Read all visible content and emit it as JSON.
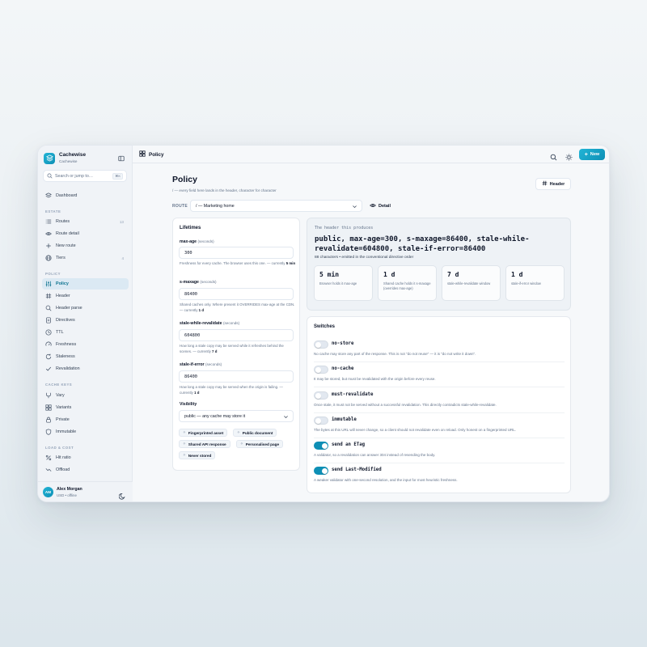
{
  "app": {
    "name": "Cachewise",
    "workspace": "Cachewise",
    "accent": "#0e8fb5"
  },
  "search": {
    "placeholder": "Search or jump to…",
    "shortcut": "⌘K"
  },
  "nav": {
    "dashboard": "Dashboard",
    "sections": [
      {
        "label": "ESTATE"
      },
      {
        "label": "POLICY"
      },
      {
        "label": "CACHE KEYS"
      },
      {
        "label": "LOAD & COST"
      }
    ],
    "estate": [
      {
        "label": "Routes",
        "count": "13",
        "icon": "list-icon"
      },
      {
        "label": "Route detail",
        "icon": "eye-icon"
      },
      {
        "label": "New route",
        "icon": "plus-icon"
      },
      {
        "label": "Tiers",
        "count": "4",
        "icon": "globe-icon"
      }
    ],
    "policy": [
      {
        "label": "Policy",
        "icon": "sliders-icon",
        "active": true
      },
      {
        "label": "Header",
        "icon": "hash-icon"
      },
      {
        "label": "Header parse",
        "icon": "search-icon"
      },
      {
        "label": "Directives",
        "icon": "doc-icon"
      },
      {
        "label": "TTL",
        "icon": "clock-icon"
      },
      {
        "label": "Freshness",
        "icon": "gauge-icon"
      },
      {
        "label": "Staleness",
        "icon": "refresh-icon"
      },
      {
        "label": "Revalidation",
        "icon": "check-icon"
      }
    ],
    "cache_keys": [
      {
        "label": "Vary",
        "icon": "fork-icon"
      },
      {
        "label": "Variants",
        "icon": "grid-icon"
      },
      {
        "label": "Private",
        "icon": "lock-icon"
      },
      {
        "label": "Immutable",
        "icon": "shield-icon"
      }
    ],
    "load_cost": [
      {
        "label": "Hit ratio",
        "icon": "percent-icon"
      },
      {
        "label": "Offload",
        "icon": "trend-icon"
      }
    ]
  },
  "user": {
    "initials": "AM",
    "name": "Alex Morgan",
    "sub": "USD • offline"
  },
  "topbar": {
    "title": "Policy",
    "new_label": "New"
  },
  "page": {
    "title": "Policy",
    "subtitle": "/ — every field here lands in the header, character for character",
    "header_button": "Header",
    "route_label": "ROUTE",
    "route_value": "/ — Marketing home",
    "detail_button": "Detail"
  },
  "lifetimes": {
    "title": "Lifetimes",
    "fields": [
      {
        "label": "max-age",
        "unit": "(seconds)",
        "value": "300",
        "help": "Freshness for every cache. The browser uses this one. — currently ",
        "current": "5 min"
      },
      {
        "label": "s-maxage",
        "unit": "(seconds)",
        "value": "86400",
        "help": "Shared caches only. Where present it OVERRIDES max-age at the CDN. — currently ",
        "current": "1 d"
      },
      {
        "label": "stale-while-revalidate",
        "unit": "(seconds)",
        "value": "604800",
        "help": "How long a stale copy may be served while it refreshes behind the scenes. — currently ",
        "current": "7 d"
      },
      {
        "label": "stale-if-error",
        "unit": "(seconds)",
        "value": "86400",
        "help": "How long a stale copy may be served when the origin is failing. — currently ",
        "current": "1 d"
      }
    ],
    "visibility_label": "Visibility",
    "visibility_value": "public — any cache may store it",
    "presets": [
      "Fingerprinted asset",
      "Public document",
      "Shared API response",
      "Personalised page",
      "Never stored"
    ]
  },
  "produces": {
    "label": "The header this produces",
    "value": "public, max-age=300, s-maxage=86400, stale-while-revalidate=604800, stale-if-error=86400",
    "meta": "88 characters • emitted in the conventional directive order",
    "stats": [
      {
        "value": "5 min",
        "desc": "Browser holds it max-age"
      },
      {
        "value": "1 d",
        "desc": "Shared cache holds it s-maxage (overrides max-age)"
      },
      {
        "value": "7 d",
        "desc": "stale-while-revalidate window"
      },
      {
        "value": "1 d",
        "desc": "stale-if-error window"
      }
    ]
  },
  "switches": {
    "title": "Switches",
    "items": [
      {
        "name": "no-store",
        "on": false,
        "desc": "No cache may store any part of the response. This is not \"do not reuse\" — it is \"do not write it down\"."
      },
      {
        "name": "no-cache",
        "on": false,
        "desc": "It may be stored, but must be revalidated with the origin before every reuse."
      },
      {
        "name": "must-revalidate",
        "on": false,
        "desc": "Once stale, it must not be served without a successful revalidation. This directly contradicts stale-while-revalidate."
      },
      {
        "name": "immutable",
        "on": false,
        "desc": "The bytes at this URL will never change, so a client should not revalidate even on reload. Only honest on a fingerprinted URL."
      },
      {
        "name": "send an ETag",
        "on": true,
        "desc": "A validator, so a revalidation can answer 304 instead of resending the body."
      },
      {
        "name": "send Last-Modified",
        "on": true,
        "desc": "A weaker validator with one-second resolution, and the input for most heuristic freshness."
      }
    ]
  }
}
